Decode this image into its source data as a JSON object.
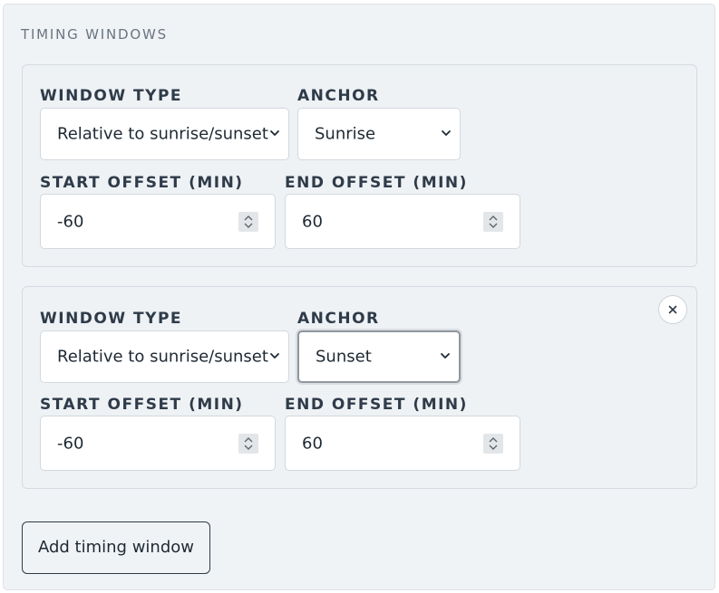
{
  "section": {
    "title": "TIMING WINDOWS"
  },
  "windows": [
    {
      "window_type_label": "WINDOW TYPE",
      "window_type_value": "Relative to sunrise/sunset",
      "anchor_label": "ANCHOR",
      "anchor_value": "Sunrise",
      "start_offset_label": "START OFFSET (MIN)",
      "start_offset_value": "-60",
      "end_offset_label": "END OFFSET (MIN)",
      "end_offset_value": "60"
    },
    {
      "window_type_label": "WINDOW TYPE",
      "window_type_value": "Relative to sunrise/sunset",
      "anchor_label": "ANCHOR",
      "anchor_value": "Sunset",
      "start_offset_label": "START OFFSET (MIN)",
      "start_offset_value": "-60",
      "end_offset_label": "END OFFSET (MIN)",
      "end_offset_value": "60",
      "remove_icon": "close-icon"
    }
  ],
  "actions": {
    "add_label": "Add timing window"
  },
  "colors": {
    "panel_bg": "#f0f3f6",
    "label_text": "#2f3b49",
    "focus_ring": "#8f969d"
  }
}
